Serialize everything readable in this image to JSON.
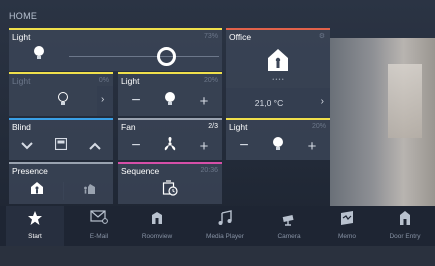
{
  "header": {
    "title": "HOME"
  },
  "tiles": {
    "light_main": {
      "title": "Light",
      "value": "73%"
    },
    "office": {
      "title": "Office",
      "temperature": "21,0 °C",
      "pager": "• • • •"
    },
    "light_small": {
      "title": "Light",
      "value": "0%"
    },
    "light_dimmer": {
      "title": "Light",
      "value": "20%"
    },
    "blind": {
      "title": "Blind"
    },
    "fan": {
      "title": "Fan",
      "value": "2/3"
    },
    "light_third": {
      "title": "Light",
      "value": "20%"
    },
    "presence": {
      "title": "Presence"
    },
    "sequence": {
      "title": "Sequence",
      "value": "20:36"
    }
  },
  "colors": {
    "yellow": "#f0e04c",
    "orange": "#e2624a",
    "blue": "#3aa0e6",
    "magenta": "#d64fa8",
    "gray": "#9aa3b0"
  },
  "nav": [
    {
      "label": "Start",
      "icon": "star-icon"
    },
    {
      "label": "E-Mail",
      "icon": "mail-icon"
    },
    {
      "label": "Roomview",
      "icon": "room-icon"
    },
    {
      "label": "Media Player",
      "icon": "music-icon"
    },
    {
      "label": "Camera",
      "icon": "camera-icon"
    },
    {
      "label": "Memo",
      "icon": "memo-icon"
    },
    {
      "label": "Door Entry",
      "icon": "door-icon"
    }
  ]
}
